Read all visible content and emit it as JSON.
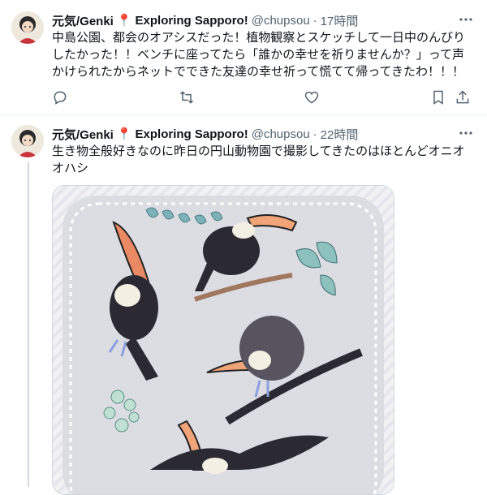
{
  "tweets": [
    {
      "display_name": "元気/Genki",
      "pin_emoji": "📍",
      "location_text": "Exploring Sapporo!",
      "handle": "@chupsou",
      "dot": "·",
      "time": "17時間",
      "text": "中島公園、都会のオアシスだった！植物観察とスケッチして一日中のんびりしたかった！！ベンチに座ってたら「誰かの幸せを祈りませんか？」って声かけられたからネットでできた友達の幸せ祈って慌てて帰ってきたわ！！！",
      "icons": [
        "reply-icon",
        "retweet-icon",
        "like-icon",
        "bookmark-icon",
        "share-icon"
      ]
    },
    {
      "display_name": "元気/Genki",
      "pin_emoji": "📍",
      "location_text": "Exploring Sapporo!",
      "handle": "@chupsou",
      "dot": "·",
      "time": "22時間",
      "text": "生き物全般好きなのに昨日の円山動物園で撮影してきたのはほとんどオニオオハシ",
      "media_description_icon": "toucan-illustration"
    }
  ],
  "colors": {
    "text": "#0f1419",
    "secondary": "#536471",
    "border": "#cfd9de",
    "pin": "#e0245e"
  }
}
